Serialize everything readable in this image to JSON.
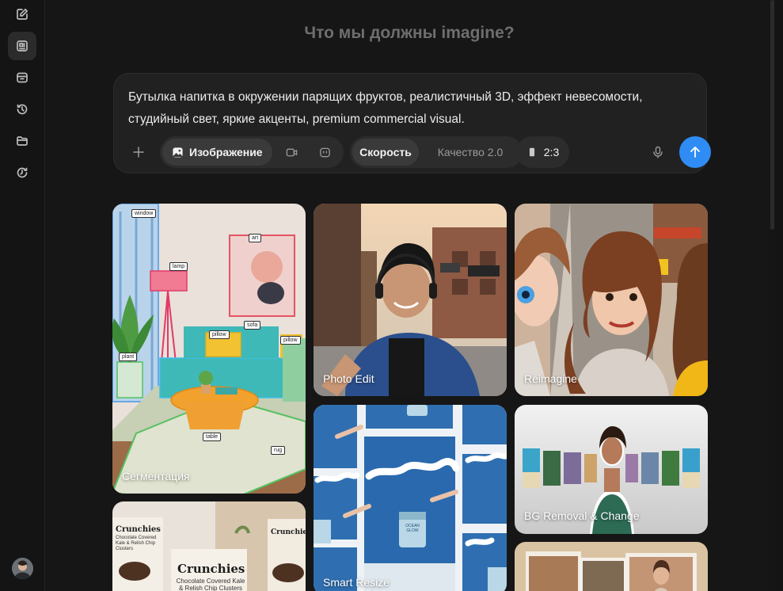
{
  "page": {
    "title": "Что мы должны imagine?"
  },
  "composer": {
    "prompt_text": "Бутылка напитка в окружении парящих фруктов, реалистичный 3D, эффект невесомости, студийный свет, яркие акценты, premium commercial visual.",
    "mode_image_label": "Изображение",
    "speed_label": "Скорость",
    "quality_label": "Качество 2.0",
    "ratio_label": "2:3"
  },
  "sidebar": {
    "items": [
      {
        "icon": "new-chat-icon"
      },
      {
        "icon": "image-gen-icon"
      },
      {
        "icon": "archive-icon"
      },
      {
        "icon": "history-icon"
      },
      {
        "icon": "folder-icon"
      },
      {
        "icon": "restore-icon"
      }
    ]
  },
  "gallery": {
    "cards": [
      {
        "label": "Сегментация"
      },
      {
        "label": "Photo Edit"
      },
      {
        "label": "Reimagine"
      },
      {
        "label": "Smart Resize"
      },
      {
        "label": "BG Removal & Change"
      }
    ],
    "segmentation_tags": [
      "window",
      "art",
      "lamp",
      "sofa",
      "pillow",
      "pillow",
      "plant",
      "table",
      "rug"
    ],
    "crunchies_brand": "Crunchies",
    "crunchies_subtitle": "Chocolate Covered Kale & Relish Chip Clusters",
    "jar_label": "OCEAN GLOW"
  },
  "colors": {
    "accent": "#2f8cf5",
    "background": "#161616",
    "composer": "#212121"
  }
}
